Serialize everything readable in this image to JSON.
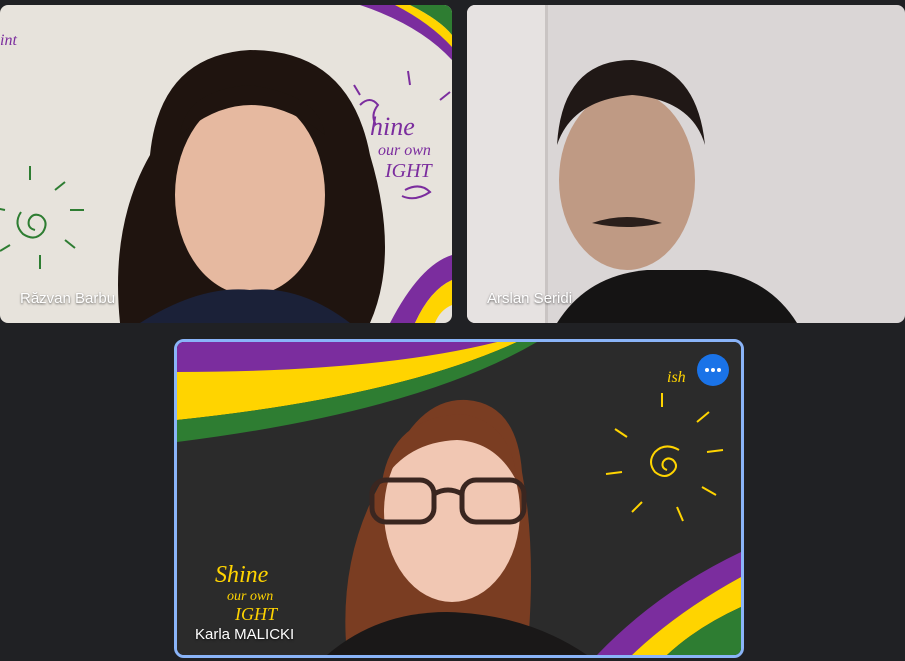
{
  "participants": [
    {
      "name": "Răzvan Barbu",
      "background": "light-paper-shine-your-own-light"
    },
    {
      "name": "Arslan Seridi",
      "background": "plain-wall"
    },
    {
      "name": "Karla MALICKI",
      "background": "chalkboard-shine-your-own-light",
      "active_speaker": true
    }
  ],
  "more_options": {
    "icon": "more-horiz-icon"
  },
  "colors": {
    "page_bg": "#202124",
    "active_border": "#8ab4f8",
    "button_blue": "#1a73e8",
    "purple": "#7b2d9e",
    "yellow": "#ffd400",
    "green": "#2e7d32"
  }
}
